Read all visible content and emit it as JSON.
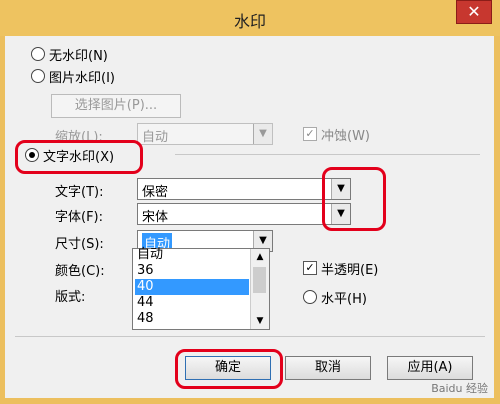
{
  "window": {
    "title": "水印",
    "close_glyph": "✕"
  },
  "options": {
    "no_watermark": "无水印(N)",
    "picture_watermark": "图片水印(I)",
    "select_picture": "选择图片(P)...",
    "scale_label": "缩放(L):",
    "scale_value": "自动",
    "washout_label": "冲蚀(W)",
    "text_watermark": "文字水印(X)",
    "text_label": "文字(T):",
    "text_value": "保密",
    "font_label": "字体(F):",
    "font_value": "宋体",
    "size_label": "尺寸(S):",
    "size_value": "自动",
    "color_label": "颜色(C):",
    "layout_label": "版式:",
    "semi_transparent": "半透明(E)",
    "horizontal": "水平(H)"
  },
  "size_list": [
    "自动",
    "36",
    "40",
    "44",
    "48"
  ],
  "size_list_selected_index": 2,
  "buttons": {
    "ok": "确定",
    "cancel": "取消",
    "apply": "应用(A)"
  },
  "site_watermark": "Baidu 经验",
  "colors": {
    "highlight": "#e3001b",
    "selection": "#3399ff",
    "titlebar": "#eec360",
    "close": "#c7372f"
  }
}
